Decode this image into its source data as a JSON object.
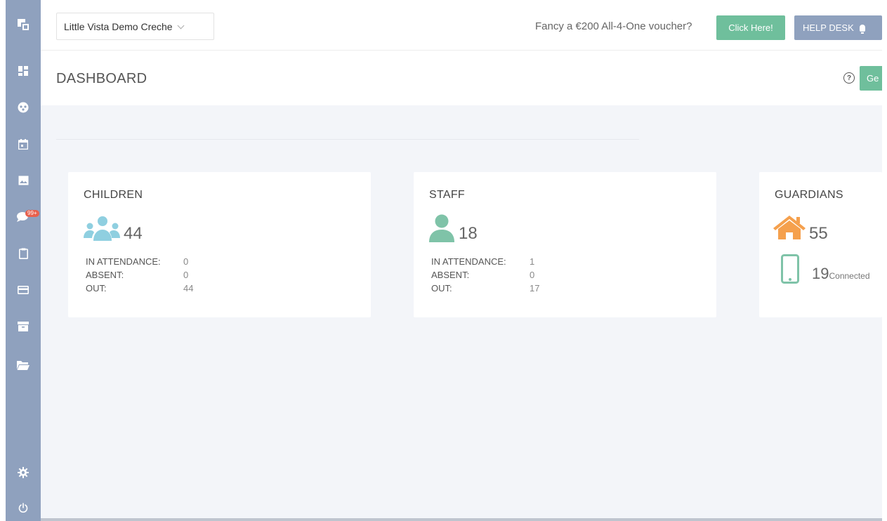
{
  "sidebar": {
    "icons": [
      {
        "name": "logo-icon"
      },
      {
        "name": "dashboard-icon"
      },
      {
        "name": "children-icon"
      },
      {
        "name": "calendar-icon"
      },
      {
        "name": "gallery-icon"
      },
      {
        "name": "messages-icon"
      },
      {
        "name": "clipboard-icon"
      },
      {
        "name": "billing-card-icon"
      },
      {
        "name": "archive-icon"
      },
      {
        "name": "folder-icon"
      },
      {
        "name": "settings-gear-icon"
      },
      {
        "name": "power-icon"
      }
    ],
    "messages_badge": "99+"
  },
  "topbar": {
    "creche_select_value": "Little Vista Demo Creche",
    "voucher_text": "Fancy a €200 All-4-One voucher?",
    "click_here_label": "Click Here!",
    "help_desk_label": "HELP DESK"
  },
  "header": {
    "title": "DASHBOARD",
    "help_symbol": "?",
    "action_button_label": "Ge"
  },
  "cards": {
    "children": {
      "title": "CHILDREN",
      "count": "44",
      "stats": [
        {
          "label": "IN ATTENDANCE:",
          "value": "0"
        },
        {
          "label": "ABSENT:",
          "value": "0"
        },
        {
          "label": "OUT:",
          "value": "44"
        }
      ]
    },
    "staff": {
      "title": "STAFF",
      "count": "18",
      "stats": [
        {
          "label": "IN ATTENDANCE:",
          "value": "1"
        },
        {
          "label": "ABSENT:",
          "value": "0"
        },
        {
          "label": "OUT:",
          "value": "17"
        }
      ]
    },
    "guardians": {
      "title": "GUARDIANS",
      "count": "55",
      "connected_count": "19",
      "connected_label": "Connected"
    }
  },
  "colors": {
    "sidebar": "#8fa1be",
    "accent_green": "#6fbf9c",
    "children_icon": "#8fcfe0",
    "staff_icon": "#7fc3a8",
    "guardians_house": "#f5a04d",
    "badge": "#e8604c"
  }
}
